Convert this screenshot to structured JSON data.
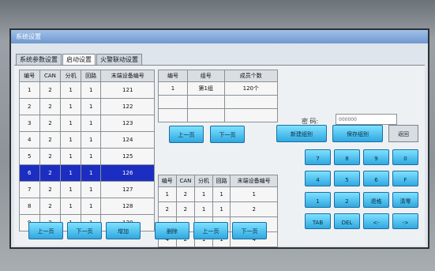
{
  "window": {
    "title": "系统设置"
  },
  "tabs": [
    "系统参数设置",
    "启动设置",
    "火警联动设置"
  ],
  "table1": {
    "headers": [
      "编号",
      "CAN",
      "分机",
      "回路",
      "末端设备编号"
    ],
    "rows": [
      [
        "1",
        "2",
        "1",
        "1",
        "121"
      ],
      [
        "2",
        "2",
        "1",
        "1",
        "122"
      ],
      [
        "3",
        "2",
        "1",
        "1",
        "123"
      ],
      [
        "4",
        "2",
        "1",
        "1",
        "124"
      ],
      [
        "5",
        "2",
        "1",
        "1",
        "125"
      ],
      [
        "6",
        "2",
        "1",
        "1",
        "126"
      ],
      [
        "7",
        "2",
        "1",
        "1",
        "127"
      ],
      [
        "8",
        "2",
        "1",
        "1",
        "128"
      ],
      [
        "9",
        "2",
        "1",
        "1",
        "129"
      ]
    ],
    "selected_index": 5
  },
  "table2": {
    "headers": [
      "编号",
      "组号",
      "成员个数"
    ],
    "rows": [
      [
        "1",
        "第1组",
        "120个"
      ],
      [
        "",
        "",
        ""
      ],
      [
        "",
        "",
        ""
      ]
    ]
  },
  "table3": {
    "headers": [
      "编号",
      "CAN",
      "分机",
      "回路",
      "末端设备编号"
    ],
    "rows": [
      [
        "1",
        "2",
        "1",
        "1",
        "1"
      ],
      [
        "2",
        "2",
        "1",
        "1",
        "2"
      ],
      [
        "3",
        "2",
        "1",
        "1",
        "3"
      ],
      [
        "4",
        "2",
        "1",
        "1",
        "4"
      ]
    ]
  },
  "password": {
    "label": "密 码:",
    "value": "000000"
  },
  "buttons": {
    "t1_prev": "上一页",
    "t1_next": "下一页",
    "add": "增加",
    "delete": "删除",
    "t3_prev": "上一页",
    "t3_next": "下一页",
    "t2_prev": "上一页",
    "t2_next": "下一页",
    "new_group": "新建组别",
    "save_group": "保存组别",
    "back": "返回"
  },
  "keypad": [
    "7",
    "8",
    "9",
    "0",
    "4",
    "5",
    "6",
    "F",
    "1",
    "2",
    "3",
    "退格",
    "清零",
    "TAB",
    "DEL",
    "<-",
    "->"
  ],
  "colors": {
    "selected_row": "#1c2ec2",
    "button": "#2fa8e0"
  }
}
